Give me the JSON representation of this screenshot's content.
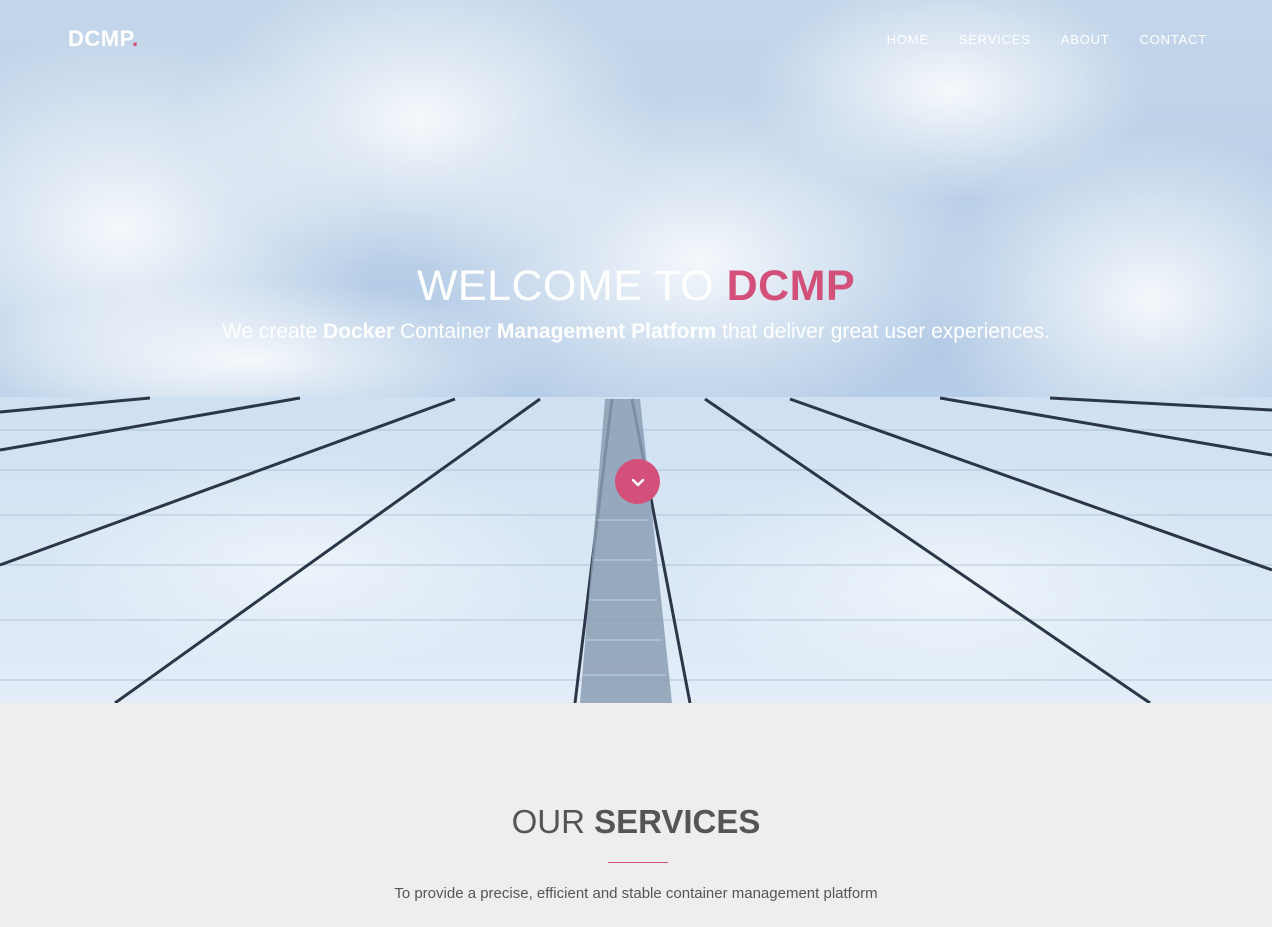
{
  "header": {
    "logo_text": "DCMP",
    "logo_dot": ".",
    "nav": [
      {
        "label": "HOME"
      },
      {
        "label": "SERVICES"
      },
      {
        "label": "ABOUT"
      },
      {
        "label": "CONTACT"
      }
    ]
  },
  "hero": {
    "title_prefix": "WELCOME TO ",
    "title_accent": "DCMP",
    "subtitle": {
      "part1": "We create ",
      "bold1": "Docker",
      "part2": " Container ",
      "bold2": "Management Platform",
      "part3": " that deliver great user experiences."
    },
    "scroll_icon": "chevron-down-icon"
  },
  "services": {
    "title_light": "OUR ",
    "title_bold": "SERVICES",
    "description": "To provide a precise, efficient and stable container management platform"
  },
  "colors": {
    "accent": "#d3507a",
    "section_bg": "#eeeeee",
    "text_dark": "#555555"
  }
}
